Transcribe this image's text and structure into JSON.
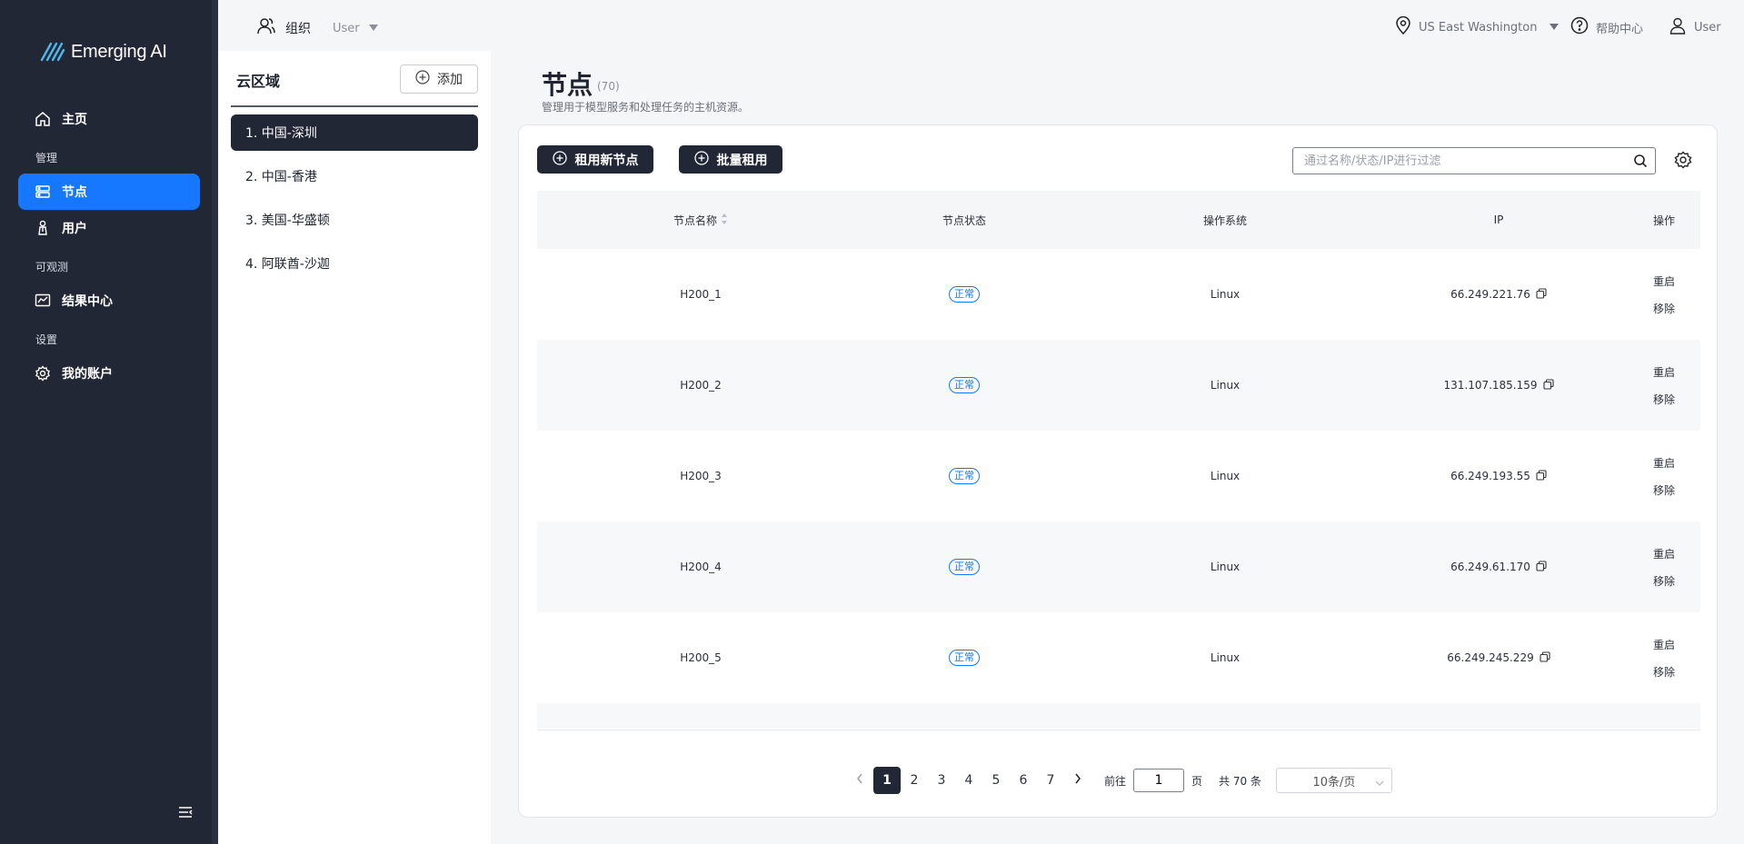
{
  "brand": {
    "name": "Emerging AI"
  },
  "sidebar": {
    "home": "主页",
    "section_manage": "管理",
    "nodes": "节点",
    "users": "用户",
    "section_observe": "可观测",
    "results": "结果中心",
    "section_settings": "设置",
    "account": "我的账户"
  },
  "topbar": {
    "org_label": "组织",
    "org_user": "User",
    "region": "US East Washington",
    "help": "帮助中心",
    "user": "User"
  },
  "regions": {
    "title": "云区域",
    "add_label": "添加",
    "items": [
      {
        "label": "1. 中国-深圳"
      },
      {
        "label": "2. 中国-香港"
      },
      {
        "label": "3. 美国-华盛顿"
      },
      {
        "label": "4. 阿联酋-沙迦"
      }
    ]
  },
  "page": {
    "title": "节点",
    "count": "(70)",
    "description": "管理用于模型服务和处理任务的主机资源。"
  },
  "toolbar": {
    "rent_new": "租用新节点",
    "batch_rent": "批量租用",
    "search_placeholder": "通过名称/状态/IP进行过滤"
  },
  "table": {
    "headers": [
      "节点名称",
      "节点状态",
      "操作系统",
      "IP",
      "操作"
    ],
    "rows": [
      {
        "name": "H200_1",
        "status": "正常",
        "os": "Linux",
        "ip": "66.249.221.76",
        "action1": "重启",
        "action2": "移除"
      },
      {
        "name": "H200_2",
        "status": "正常",
        "os": "Linux",
        "ip": "131.107.185.159",
        "action1": "重启",
        "action2": "移除"
      },
      {
        "name": "H200_3",
        "status": "正常",
        "os": "Linux",
        "ip": "66.249.193.55",
        "action1": "重启",
        "action2": "移除"
      },
      {
        "name": "H200_4",
        "status": "正常",
        "os": "Linux",
        "ip": "66.249.61.170",
        "action1": "重启",
        "action2": "移除"
      },
      {
        "name": "H200_5",
        "status": "正常",
        "os": "Linux",
        "ip": "66.249.245.229",
        "action1": "重启",
        "action2": "移除"
      }
    ]
  },
  "pagination": {
    "pages": [
      "1",
      "2",
      "3",
      "4",
      "5",
      "6",
      "7"
    ],
    "current": "1",
    "goto_prefix": "前往",
    "goto_value": "1",
    "goto_suffix": "页",
    "total": "共 70 条",
    "page_size": "10条/页"
  },
  "colors": {
    "sidebar_bg": "#222736",
    "accent": "#1677ff",
    "status_ok": "#1677ff"
  },
  "icons": [
    "logo-icon",
    "home-icon",
    "server-icon",
    "user-tie-icon",
    "chart-icon",
    "gear-icon",
    "menu-collapse-icon",
    "org-users-icon",
    "location-pin-icon",
    "help-icon",
    "user-icon",
    "plus-circle-icon",
    "search-icon",
    "settings-icon",
    "copy-icon",
    "sort-icon",
    "chevron-left-icon",
    "chevron-right-icon",
    "chevron-down-icon"
  ]
}
